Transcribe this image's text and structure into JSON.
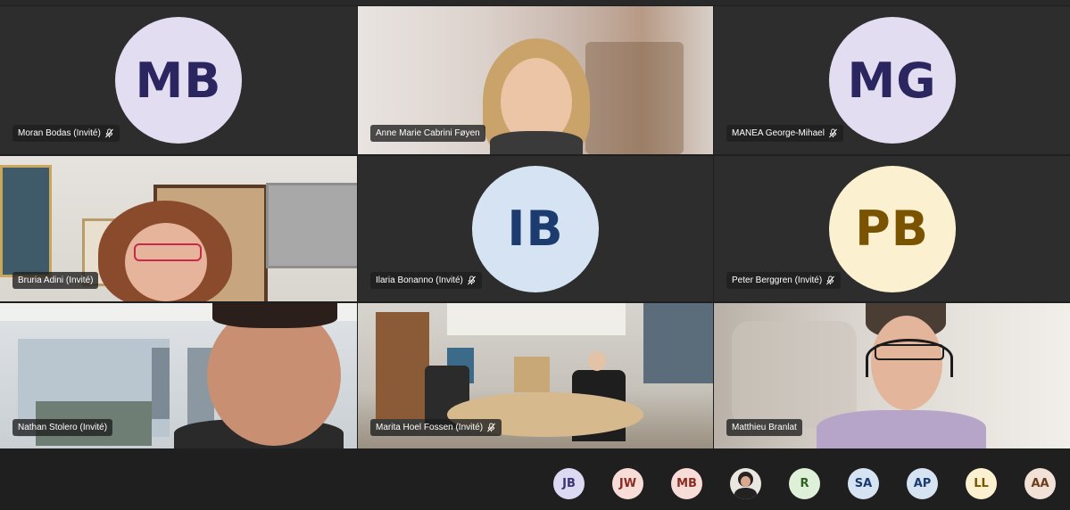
{
  "tiles": [
    {
      "name": "Moran Bodas (Invité)",
      "initials": "MB",
      "type": "avatar",
      "bg": "#e3ddf2",
      "fg": "#2b2660",
      "muted": true
    },
    {
      "name": "Anne Marie Cabrini Føyen",
      "type": "video",
      "muted": false
    },
    {
      "name": "MANEA George-Mihael",
      "initials": "MG",
      "type": "avatar",
      "bg": "#e3ddf2",
      "fg": "#2b2660",
      "muted": true
    },
    {
      "name": "Bruria Adini (Invité)",
      "type": "video",
      "muted": false
    },
    {
      "name": "Ilaria Bonanno (Invité)",
      "initials": "IB",
      "type": "avatar",
      "bg": "#d6e3f2",
      "fg": "#1c3b6e",
      "muted": true
    },
    {
      "name": "Peter Berggren (Invité)",
      "initials": "PB",
      "type": "avatar",
      "bg": "#fbf0cf",
      "fg": "#7a5300",
      "muted": true
    },
    {
      "name": "Nathan Stolero (Invité)",
      "type": "video",
      "muted": false
    },
    {
      "name": "Marita Hoel Fossen (Invité)",
      "type": "video",
      "muted": true
    },
    {
      "name": "Matthieu Branlat",
      "type": "video",
      "muted": false
    }
  ],
  "roster": [
    {
      "initials": "JB",
      "bg": "#dcd9f3",
      "fg": "#3b3475"
    },
    {
      "initials": "JW",
      "bg": "#f8dcd8",
      "fg": "#8a2e21"
    },
    {
      "initials": "MB",
      "bg": "#f8dcd8",
      "fg": "#8a2e21"
    },
    {
      "initials": "",
      "bg": "#e9e9e9",
      "fg": "#333",
      "photo": true
    },
    {
      "initials": "R",
      "bg": "#dff0d8",
      "fg": "#2f5f22"
    },
    {
      "initials": "SA",
      "bg": "#d6e3f2",
      "fg": "#1c3b6e"
    },
    {
      "initials": "AP",
      "bg": "#d6e3f2",
      "fg": "#1c3b6e"
    },
    {
      "initials": "LL",
      "bg": "#fbf0cf",
      "fg": "#7a5300"
    },
    {
      "initials": "AA",
      "bg": "#f1e1d6",
      "fg": "#6b3d1f"
    }
  ]
}
